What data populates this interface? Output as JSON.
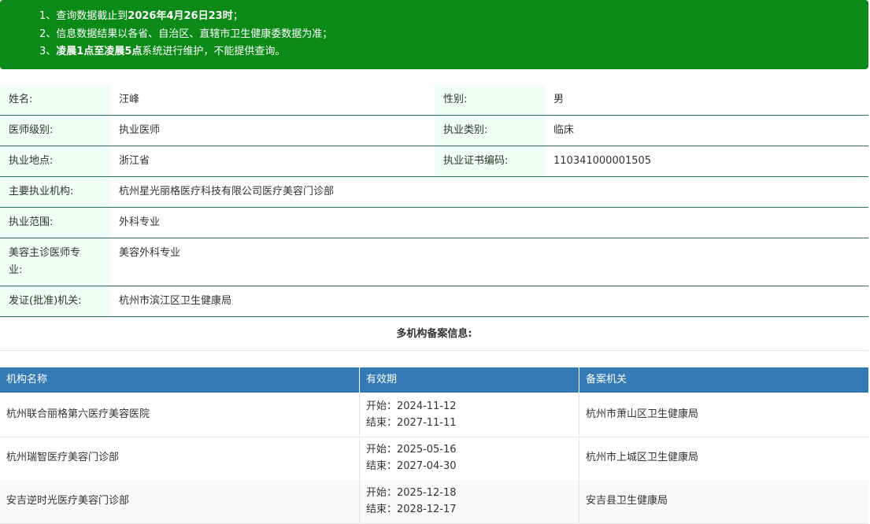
{
  "notice": {
    "line1_prefix": "1、查询数据截止到",
    "line1_bold": "2026年4月26日23时",
    "line1_suffix": "；",
    "line2": "2、信息数据结果以各省、自治区、直辖市卫生健康委数据为准；",
    "line3_prefix": "3、",
    "line3_bold": "凌晨1点至凌晨5点",
    "line3_suffix": "系统进行维护，不能提供查询。"
  },
  "profile": {
    "name_label": "姓名:",
    "name_value": "汪峰",
    "gender_label": "性别:",
    "gender_value": "男",
    "level_label": "医师级别:",
    "level_value": "执业医师",
    "category_label": "执业类别:",
    "category_value": "临床",
    "location_label": "执业地点:",
    "location_value": "浙江省",
    "cert_label": "执业证书编码:",
    "cert_value": "110341000001505",
    "institution_label": "主要执业机构:",
    "institution_value": "杭州星光丽格医疗科技有限公司医疗美容门诊部",
    "scope_label": "执业范围:",
    "scope_value": "外科专业",
    "cosmetic_label_line1": "美容主诊医师专",
    "cosmetic_label_line2": "业:",
    "cosmetic_value": "美容外科专业",
    "issuer_label": "发证(批准)机关:",
    "issuer_value": "杭州市滨江区卫生健康局"
  },
  "multi_title": "多机构备案信息:",
  "table": {
    "headers": [
      "机构名称",
      "有效期",
      "备案机关"
    ],
    "rows": [
      {
        "name": "杭州联合丽格第六医疗美容医院",
        "start": "开始：2024-11-12",
        "end": "结束：2027-11-11",
        "authority": "杭州市萧山区卫生健康局"
      },
      {
        "name": "杭州瑞智医疗美容门诊部",
        "start": "开始：2025-05-16",
        "end": "结束：2027-04-30",
        "authority": "杭州市上城区卫生健康局"
      },
      {
        "name": "安吉逆时光医疗美容门诊部",
        "start": "开始：2025-12-18",
        "end": "结束：2028-12-17",
        "authority": "安吉县卫生健康局"
      }
    ]
  },
  "colors": {
    "notice_bg": "#0b8a17",
    "label_bg": "#f0fff5",
    "row_border": "#2c6e63",
    "table_header_bg": "#337ab7"
  }
}
